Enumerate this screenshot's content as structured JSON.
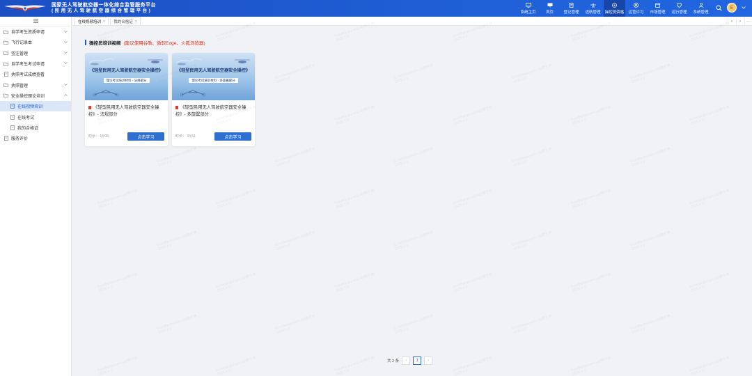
{
  "header": {
    "title_line1": "国家无人驾驶航空器一体化综合监管服务平台",
    "title_line2": "(民用无人驾驶航空器综合管理平台)",
    "nav": [
      {
        "label": "系统主页",
        "icon": "monitor-icon"
      },
      {
        "label": "首页",
        "icon": "desktop-icon"
      },
      {
        "label": "登记管理",
        "icon": "document-icon"
      },
      {
        "label": "适航管理",
        "icon": "airplane-icon"
      },
      {
        "label": "操控员资格",
        "icon": "user-circle-icon",
        "active": true
      },
      {
        "label": "运营许可",
        "icon": "at-icon"
      },
      {
        "label": "市场管理",
        "icon": "calendar-icon"
      },
      {
        "label": "运行管理",
        "icon": "shield-icon"
      },
      {
        "label": "系统管理",
        "icon": "people-icon"
      }
    ],
    "avatar_letter": "E"
  },
  "sidebar": {
    "items": [
      {
        "label": "自学考生资质申请",
        "icon": "folder-icon",
        "expand": true
      },
      {
        "label": "飞行记录本",
        "icon": "folder-icon",
        "expand": true
      },
      {
        "label": "签注管理",
        "icon": "folder-icon",
        "expand": true
      },
      {
        "label": "自学考生考试申请",
        "icon": "folder-icon",
        "expand": true
      },
      {
        "label": "执照考试成绩查看",
        "icon": "doc-icon",
        "expand": false
      },
      {
        "label": "执照管理",
        "icon": "folder-icon",
        "expand": true
      },
      {
        "label": "安全操控理论培训",
        "icon": "folder-icon",
        "expand": true,
        "open": true
      },
      {
        "label": "在线视频培训",
        "icon": "doc-icon",
        "sub": true,
        "active": true
      },
      {
        "label": "在线考试",
        "icon": "doc-icon",
        "sub": true
      },
      {
        "label": "我的合格证",
        "icon": "doc-icon",
        "sub": true
      },
      {
        "label": "服务评价",
        "icon": "doc-icon",
        "expand": false
      }
    ]
  },
  "tabs": [
    {
      "label": "在线视频培训",
      "active": true,
      "closable": true
    },
    {
      "label": "我的合格证",
      "active": false,
      "closable": true
    }
  ],
  "main": {
    "section_title": "操控员培训视频",
    "section_note": "(建议使用谷歌、微软Edge、火狐浏览器)",
    "cards": [
      {
        "thumb_title": "《轻型民用无人驾驶航空器安全操控》",
        "thumb_sub": "理论考试培训材料 - 法规部分",
        "title": "《轻型民用无人驾驶航空器安全操控》- 法规部分",
        "duration": "时长：  15:08",
        "button": "点击学习"
      },
      {
        "thumb_title": "《轻型民用无人驾驶航空器安全操控》",
        "thumb_sub": "理论考试培训材料 - 多旋翼部分",
        "title": "《轻型民用无人驾驶航空器安全操控》- 多旋翼部分",
        "duration": "时长：  33:51",
        "button": "点击学习"
      }
    ]
  },
  "pager": {
    "total": "共 2 条",
    "current": "1"
  },
  "watermark": {
    "line1": "EnzeBaogunaoLu@朗于林",
    "line2": "2025-1-2"
  },
  "colors": {
    "header_blue": "#1f5fd6",
    "accent": "#2f6fd1",
    "note_red": "#e0301e"
  }
}
